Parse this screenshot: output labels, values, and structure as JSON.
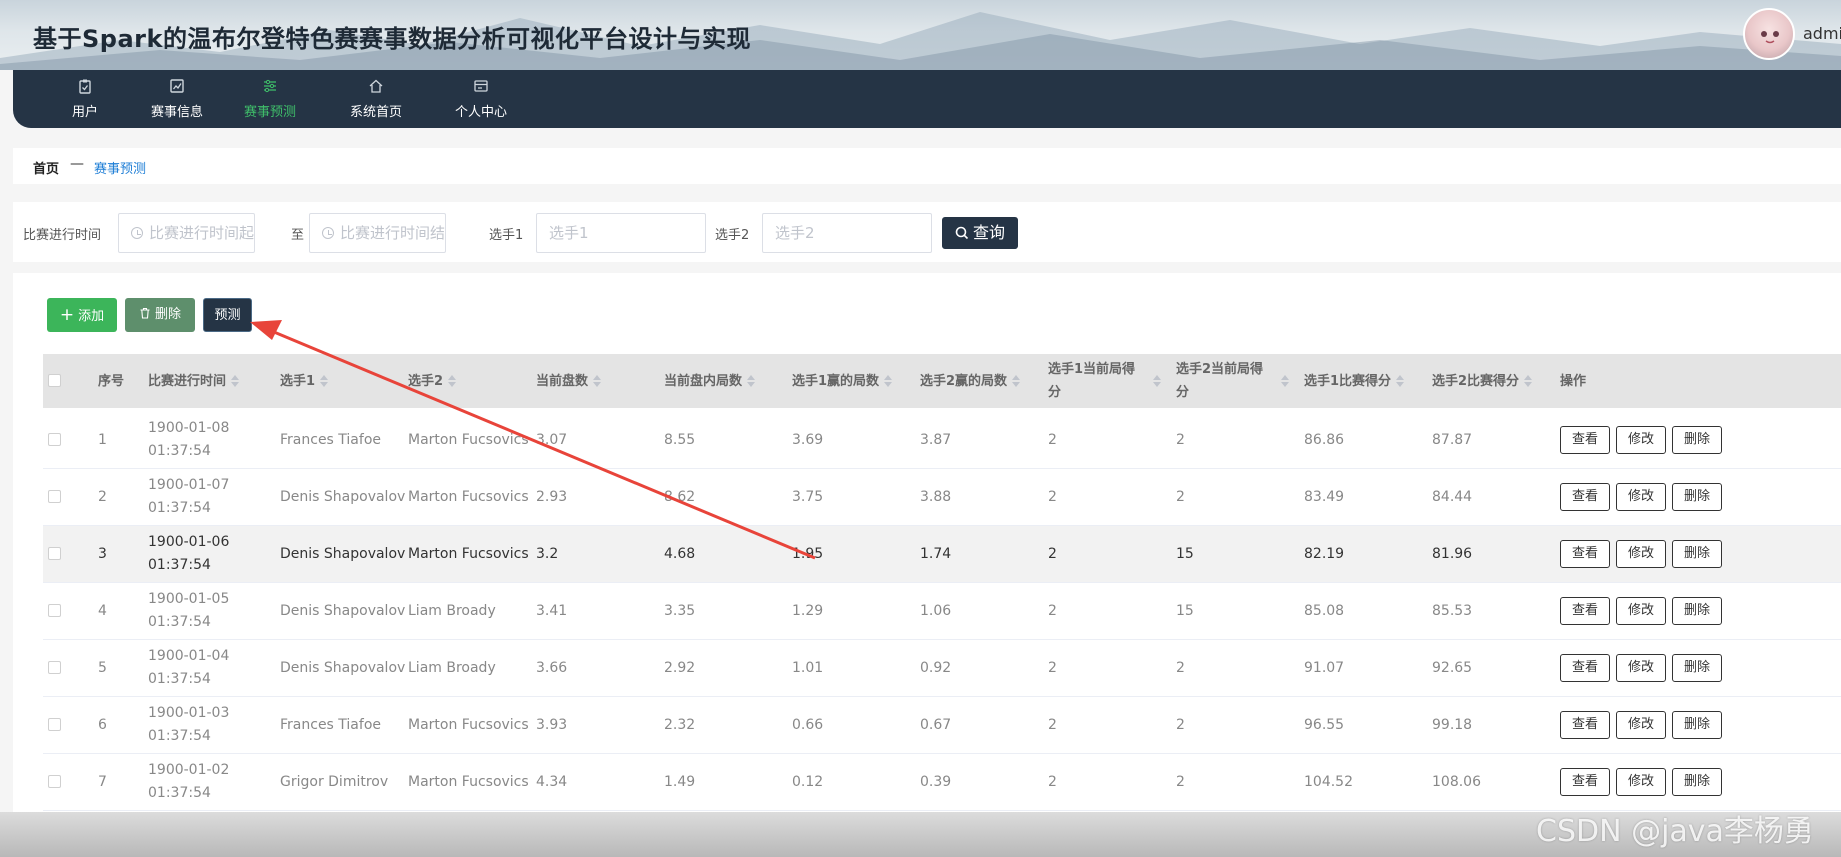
{
  "app": {
    "title": "基于Spark的温布尔登特色赛赛事数据分析可视化平台设计与实现",
    "username": "admin"
  },
  "nav": [
    {
      "label": "用户",
      "icon": "clipboard-icon",
      "active": false
    },
    {
      "label": "赛事信息",
      "icon": "chart-icon",
      "active": false
    },
    {
      "label": "赛事预测",
      "icon": "sliders-icon",
      "active": true
    },
    {
      "label": "系统首页",
      "icon": "home-icon",
      "active": false
    },
    {
      "label": "个人中心",
      "icon": "card-icon",
      "active": false
    }
  ],
  "breadcrumb": {
    "home": "首页",
    "separator": "—",
    "current": "赛事预测"
  },
  "search": {
    "time_label": "比赛进行时间",
    "time_start_placeholder": "比赛进行时间起始",
    "to_label": "至",
    "time_end_placeholder": "比赛进行时间结束",
    "player1_label": "选手1",
    "player1_placeholder": "选手1",
    "player2_label": "选手2",
    "player2_placeholder": "选手2",
    "search_button": "查询"
  },
  "toolbar": {
    "add": "添加",
    "delete": "删除",
    "predict": "预测"
  },
  "table": {
    "columns": [
      "序号",
      "比赛进行时间",
      "选手1",
      "选手2",
      "当前盘数",
      "当前盘内局数",
      "选手1赢的局数",
      "选手2赢的局数",
      "选手1当前局得分",
      "选手2当前局得分",
      "选手1比赛得分",
      "选手2比赛得分",
      "操作"
    ],
    "actions": {
      "view": "查看",
      "edit": "修改",
      "delete": "删除"
    },
    "rows": [
      {
        "idx": "1",
        "time": "1900-01-08 01:37:54",
        "p1": "Frances Tiafoe",
        "p2": "Marton Fucsovics",
        "set": "3.07",
        "games": "8.55",
        "p1_games": "3.69",
        "p2_games": "3.87",
        "p1_pts": "2",
        "p2_pts": "2",
        "p1_score": "86.86",
        "p2_score": "87.87"
      },
      {
        "idx": "2",
        "time": "1900-01-07 01:37:54",
        "p1": "Denis Shapovalov",
        "p2": "Marton Fucsovics",
        "set": "2.93",
        "games": "8.62",
        "p1_games": "3.75",
        "p2_games": "3.88",
        "p1_pts": "2",
        "p2_pts": "2",
        "p1_score": "83.49",
        "p2_score": "84.44"
      },
      {
        "idx": "3",
        "time": "1900-01-06 01:37:54",
        "p1": "Denis Shapovalov",
        "p2": "Marton Fucsovics",
        "set": "3.2",
        "games": "4.68",
        "p1_games": "1.95",
        "p2_games": "1.74",
        "p1_pts": "2",
        "p2_pts": "15",
        "p1_score": "82.19",
        "p2_score": "81.96"
      },
      {
        "idx": "4",
        "time": "1900-01-05 01:37:54",
        "p1": "Denis Shapovalov",
        "p2": "Liam Broady",
        "set": "3.41",
        "games": "3.35",
        "p1_games": "1.29",
        "p2_games": "1.06",
        "p1_pts": "2",
        "p2_pts": "15",
        "p1_score": "85.08",
        "p2_score": "85.53"
      },
      {
        "idx": "5",
        "time": "1900-01-04 01:37:54",
        "p1": "Denis Shapovalov",
        "p2": "Liam Broady",
        "set": "3.66",
        "games": "2.92",
        "p1_games": "1.01",
        "p2_games": "0.92",
        "p1_pts": "2",
        "p2_pts": "2",
        "p1_score": "91.07",
        "p2_score": "92.65"
      },
      {
        "idx": "6",
        "time": "1900-01-03 01:37:54",
        "p1": "Frances Tiafoe",
        "p2": "Marton Fucsovics",
        "set": "3.93",
        "games": "2.32",
        "p1_games": "0.66",
        "p2_games": "0.67",
        "p1_pts": "2",
        "p2_pts": "2",
        "p1_score": "96.55",
        "p2_score": "99.18"
      },
      {
        "idx": "7",
        "time": "1900-01-02 01:37:54",
        "p1": "Grigor Dimitrov",
        "p2": "Marton Fucsovics",
        "set": "4.34",
        "games": "1.49",
        "p1_games": "0.12",
        "p2_games": "0.39",
        "p1_pts": "2",
        "p2_pts": "2",
        "p1_score": "104.52",
        "p2_score": "108.06"
      }
    ]
  },
  "watermark": "CSDN @java李杨勇",
  "colors": {
    "nav_bg": "#253445",
    "active": "#3fbf6a",
    "add_btn": "#3cb55a",
    "delete_btn": "#5e8f6c",
    "arrow": "#e8443a"
  }
}
